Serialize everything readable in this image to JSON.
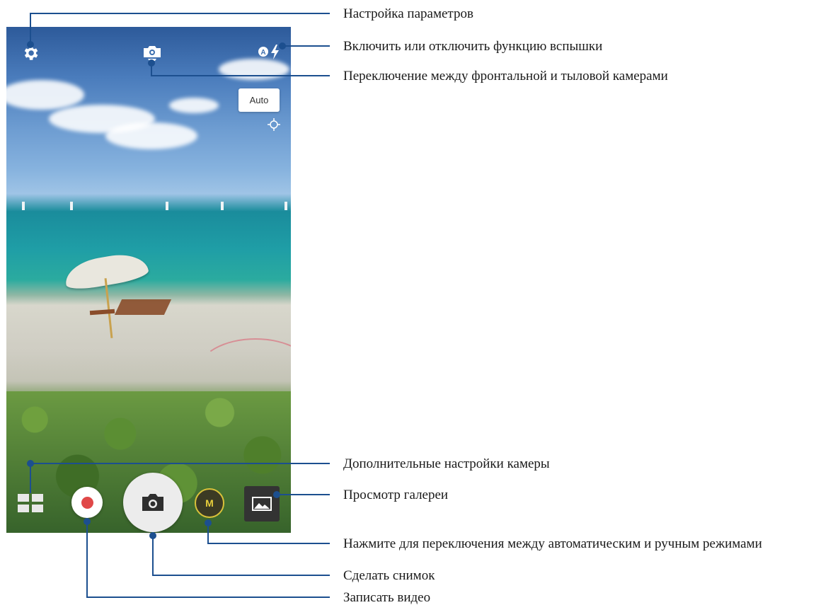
{
  "viewfinder": {
    "focus_mode_badge": "Auto",
    "icons": {
      "settings": "gear-icon",
      "camera_switch": "camera-switch-icon",
      "flash": "auto-flash-icon",
      "exposure": "exposure-crosshair-icon",
      "advanced_settings": "grid-menu-icon",
      "record": "record-dot-icon",
      "shutter": "camera-icon",
      "gallery": "gallery-picture-icon"
    },
    "flash_badge_letter": "A",
    "mode_button_label": "M"
  },
  "callouts": {
    "settings": "Настройка параметров",
    "flash": "Включить или отключить функцию вспышки",
    "camera_switch": "Переключение между фронтальной и тыловой камерами",
    "advanced_settings": "Дополнительные настройки камеры",
    "gallery": "Просмотр галереи",
    "mode_switch": "Нажмите для переключения между автоматическим и ручным режимами",
    "take_photo": "Сделать снимок",
    "record_video": "Записать видео"
  },
  "colors": {
    "callout_line": "#1c4f8f",
    "record_red": "#e04848",
    "mode_accent": "#d9c13a"
  }
}
